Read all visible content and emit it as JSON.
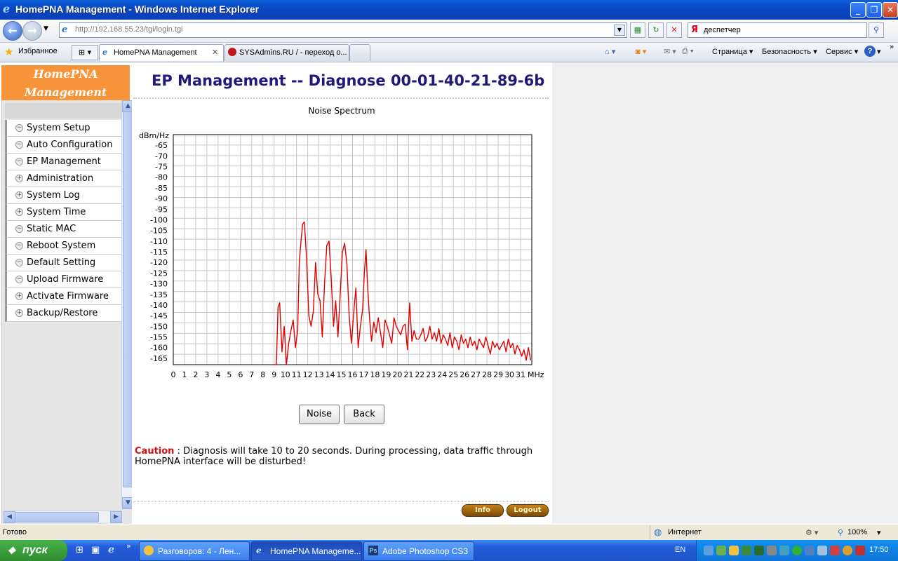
{
  "window": {
    "title": "HomePNA Management - Windows Internet Explorer",
    "controls": [
      "_",
      "❐",
      "✕"
    ]
  },
  "browser": {
    "url": "http://192.168.55.23/tgi/login.tgi",
    "search_query": "деспетчер",
    "favorites_label": "Избранное",
    "tabs": [
      {
        "label": "HomePNA Management"
      },
      {
        "label": "SYSAdmins.RU / - переход о..."
      }
    ],
    "toolbar": {
      "page": "Страница",
      "safety": "Безопасность",
      "service": "Сервис"
    }
  },
  "sidebar": {
    "brand_line1": "HomePNA",
    "brand_line2": "Management",
    "items": [
      {
        "label": "System Setup",
        "bullet": "−"
      },
      {
        "label": "Auto Configuration",
        "bullet": "−"
      },
      {
        "label": "EP Management",
        "bullet": "−"
      },
      {
        "label": "Administration",
        "bullet": "+"
      },
      {
        "label": "System Log",
        "bullet": "+"
      },
      {
        "label": "System Time",
        "bullet": "+"
      },
      {
        "label": "Static MAC",
        "bullet": "−"
      },
      {
        "label": "Reboot System",
        "bullet": "−"
      },
      {
        "label": "Default Setting",
        "bullet": "−"
      },
      {
        "label": "Upload Firmware",
        "bullet": "−"
      },
      {
        "label": "Activate Firmware",
        "bullet": "+"
      },
      {
        "label": "Backup/Restore",
        "bullet": "+"
      }
    ]
  },
  "main": {
    "page_title": "EP Management -- Diagnose 00-01-40-21-89-6b",
    "noise_button": "Noise",
    "back_button": "Back",
    "caution_label": "Caution",
    "caution_text": " : Diagnosis will take 10 to 20 seconds. During processing, data traffic through HomePNA interface will be disturbed!",
    "info_button": "Info",
    "logout_button": "Logout"
  },
  "chart_data": {
    "type": "line",
    "title": "Noise Spectrum",
    "ylabel": "dBm/Hz",
    "xlabel": "MHz",
    "xlim": [
      0,
      32
    ],
    "ylim": [
      -168,
      -60
    ],
    "y_ticks": [
      -65,
      -70,
      -75,
      -80,
      -85,
      -90,
      -95,
      -100,
      -105,
      -110,
      -115,
      -120,
      -125,
      -130,
      -135,
      -140,
      -145,
      -150,
      -155,
      -160,
      -165
    ],
    "x_ticks": [
      0,
      1,
      2,
      3,
      4,
      5,
      6,
      7,
      8,
      9,
      10,
      11,
      12,
      13,
      14,
      15,
      16,
      17,
      18,
      19,
      20,
      21,
      22,
      23,
      24,
      25,
      26,
      27,
      28,
      29,
      30,
      31
    ],
    "grid": true,
    "color": "#e00000",
    "series": [
      {
        "x": [
          9.0,
          9.2,
          9.35,
          9.5,
          9.7,
          9.9,
          10.1,
          10.3,
          10.5,
          10.7,
          10.9,
          11.1,
          11.25,
          11.4,
          11.55,
          11.7,
          11.9,
          12.1,
          12.3,
          12.5,
          12.7,
          12.9,
          13.1,
          13.3,
          13.5,
          13.7,
          13.9,
          14.1,
          14.3,
          14.5,
          14.7,
          14.9,
          15.1,
          15.3,
          15.5,
          15.7,
          15.9,
          16.1,
          16.3,
          16.5,
          16.7,
          16.9,
          17.05,
          17.2,
          17.35,
          17.5,
          17.7,
          17.9,
          18.1,
          18.3,
          18.5,
          18.7,
          18.9,
          19.1,
          19.3,
          19.5,
          19.7,
          19.9,
          20.1,
          20.3,
          20.5,
          20.7,
          20.9,
          21.1,
          21.3,
          21.5,
          21.7,
          21.9,
          22.1,
          22.3,
          22.5,
          22.7,
          22.9,
          23.1,
          23.3,
          23.5,
          23.7,
          23.9,
          24.1,
          24.3,
          24.5,
          24.7,
          24.9,
          25.1,
          25.3,
          25.5,
          25.7,
          25.9,
          26.1,
          26.3,
          26.5,
          26.7,
          26.9,
          27.1,
          27.3,
          27.5,
          27.7,
          27.9,
          28.1,
          28.3,
          28.5,
          28.7,
          28.9,
          29.1,
          29.3,
          29.5,
          29.7,
          29.9,
          30.1,
          30.3,
          30.5,
          30.7,
          30.9,
          31.1,
          31.3,
          31.5,
          31.7,
          31.9
        ],
        "y": [
          -168,
          -168,
          -141,
          -139,
          -162,
          -150,
          -168,
          -158,
          -152,
          -147,
          -160,
          -152,
          -120,
          -110,
          -102,
          -101,
          -118,
          -145,
          -150,
          -143,
          -120,
          -135,
          -138,
          -155,
          -130,
          -112,
          -110,
          -128,
          -150,
          -138,
          -155,
          -135,
          -115,
          -111,
          -121,
          -145,
          -158,
          -144,
          -132,
          -160,
          -150,
          -142,
          -125,
          -114,
          -132,
          -145,
          -157,
          -148,
          -153,
          -146,
          -153,
          -160,
          -147,
          -150,
          -154,
          -158,
          -146,
          -150,
          -152,
          -154,
          -150,
          -149,
          -161,
          -139,
          -157,
          -152,
          -156,
          -156,
          -154,
          -151,
          -157,
          -155,
          -150,
          -156,
          -153,
          -157,
          -151,
          -158,
          -154,
          -156,
          -159,
          -153,
          -160,
          -155,
          -157,
          -161,
          -154,
          -158,
          -156,
          -160,
          -155,
          -159,
          -157,
          -161,
          -156,
          -158,
          -160,
          -155,
          -159,
          -163,
          -157,
          -160,
          -158,
          -161,
          -159,
          -157,
          -162,
          -156,
          -160,
          -158,
          -163,
          -159,
          -161,
          -164,
          -161,
          -166,
          -160,
          -166
        ]
      }
    ]
  },
  "status": {
    "ready": "Готово",
    "zone": "Интернет",
    "zoom": "100%"
  },
  "taskbar": {
    "start": "пуск",
    "items": [
      {
        "label": "Разговоров: 4 - Лен..."
      },
      {
        "label": "HomePNA Manageme..."
      },
      {
        "label": "Adobe Photoshop CS3"
      }
    ],
    "lang": "EN",
    "clock": "17:50"
  }
}
